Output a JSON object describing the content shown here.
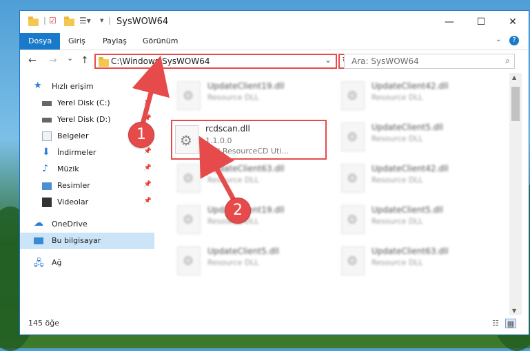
{
  "window": {
    "title": "SysWOW64",
    "minimize_glyph": "—",
    "maximize_glyph": "☐",
    "close_glyph": "✕"
  },
  "ribbon": {
    "tabs": [
      "Dosya",
      "Giriş",
      "Paylaş",
      "Görünüm"
    ],
    "expand_glyph": "?"
  },
  "nav": {
    "back_glyph": "←",
    "forward_glyph": "→",
    "recent_glyph": "⌄",
    "up_glyph": "↑",
    "address": "C:\\Windows\\SysWOW64",
    "dropdown_glyph": "⌄",
    "refresh_glyph": "↻",
    "search_placeholder": "Ara: SysWOW64",
    "search_icon_glyph": "⌕"
  },
  "sidebar": {
    "items": [
      {
        "label": "Hızlı erişim",
        "icon": "star-icon",
        "pinned": false
      },
      {
        "label": "Yerel Disk (C:)",
        "icon": "drive-icon",
        "pinned": true
      },
      {
        "label": "Yerel Disk (D:)",
        "icon": "drive-icon",
        "pinned": true
      },
      {
        "label": "Belgeler",
        "icon": "documents-icon",
        "pinned": true
      },
      {
        "label": "İndirmeler",
        "icon": "downloads-icon",
        "pinned": true
      },
      {
        "label": "Müzik",
        "icon": "music-icon",
        "pinned": true
      },
      {
        "label": "Resimler",
        "icon": "pictures-icon",
        "pinned": true
      },
      {
        "label": "Videolar",
        "icon": "videos-icon",
        "pinned": true
      },
      {
        "label": "OneDrive",
        "icon": "cloud-icon",
        "pinned": false
      },
      {
        "label": "Bu bilgisayar",
        "icon": "computer-icon",
        "pinned": false
      },
      {
        "label": "Ağ",
        "icon": "network-icon",
        "pinned": false
      }
    ],
    "pin_glyph": "📌"
  },
  "files": {
    "left_column": [
      {
        "name": "UpdateClient19.dll",
        "type": "Resource DLL"
      },
      {
        "name": "UpdateClient63.dll",
        "type": "Resource DLL"
      },
      {
        "name": "UpdateClient19.dll",
        "type": "Resource DLL"
      },
      {
        "name": "UpdateClient5.dll",
        "type": "Resource DLL"
      }
    ],
    "right_column": [
      {
        "name": "UpdateClient42.dll",
        "type": "Resource DLL"
      },
      {
        "name": "UpdateClient5.dll",
        "type": "Resource DLL"
      },
      {
        "name": "UpdateClient42.dll",
        "type": "Resource DLL"
      },
      {
        "name": "UpdateClient5.dll",
        "type": "Resource DLL"
      },
      {
        "name": "UpdateClient63.dll",
        "type": "Resource DLL"
      }
    ],
    "highlighted": {
      "name": "rcdscan.dll",
      "version": "1.1.0.0",
      "description": "Dell ResourceCD Uti..."
    }
  },
  "status": {
    "item_count": "145 öğe",
    "details_view_glyph": "☷",
    "tiles_view_glyph": "▦"
  },
  "annotations": {
    "step1": "1",
    "step2": "2",
    "color": "#e74a4a"
  },
  "scroll": {
    "up_glyph": "▲",
    "down_glyph": "▼"
  }
}
